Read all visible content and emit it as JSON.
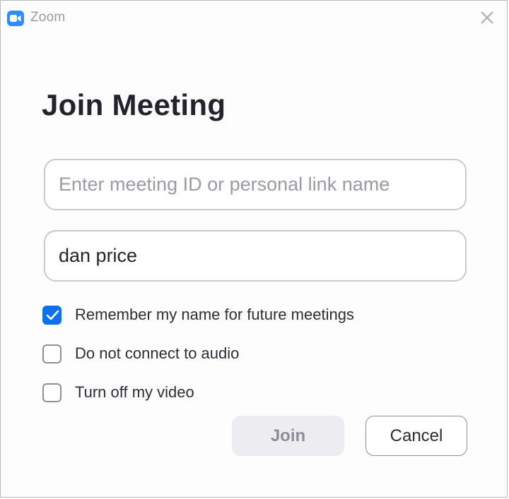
{
  "window": {
    "app_title": "Zoom",
    "app_icon": "zoom-camera-icon",
    "close_icon": "close-icon"
  },
  "dialog": {
    "heading": "Join Meeting",
    "meeting_id_field": {
      "value": "",
      "placeholder": "Enter meeting ID or personal link name"
    },
    "name_field": {
      "value": "dan price",
      "placeholder": ""
    },
    "options": [
      {
        "label": "Remember my name for future meetings",
        "checked": true
      },
      {
        "label": "Do not connect to audio",
        "checked": false
      },
      {
        "label": "Turn off my video",
        "checked": false
      }
    ],
    "join_label": "Join",
    "cancel_label": "Cancel"
  },
  "colors": {
    "accent": "#0E71EB",
    "brand": "#2D8CFF",
    "disabled_button_bg": "#ECECF1",
    "disabled_button_text": "#8D8D99"
  }
}
